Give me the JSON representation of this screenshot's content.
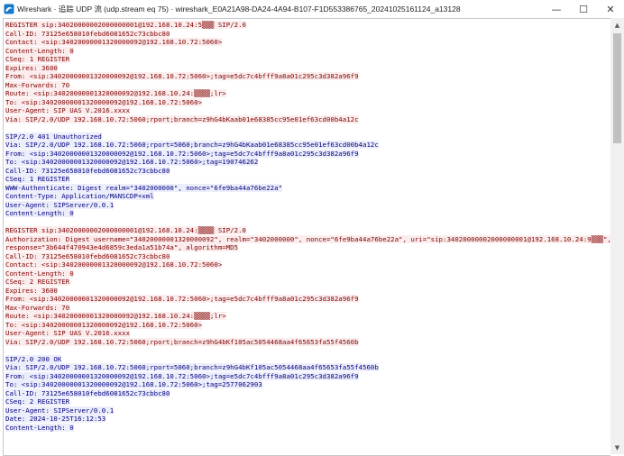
{
  "window": {
    "title": "Wireshark · 追踪 UDP 流 (udp.stream eq 75) · wireshark_E0A21A98-DA24-4A94-B107-F1D553386765_20241025161124_a13128",
    "minimize_glyph": "—",
    "maximize_glyph": "☐",
    "close_glyph": "✕"
  },
  "colors": {
    "client_fg": "#7f0000",
    "client_bg": "#fbeded",
    "server_fg": "#00007f",
    "server_bg": "#edeefb"
  },
  "blocks": [
    {
      "dir": "client",
      "lines": [
        "REGISTER sip:34020000002000000001@192.168.10.24:5▒▒▒ SIP/2.0",
        "Call-ID: 73125e658010febd6081652c73cbbc80",
        "Contact: <sip:34020000001320000092@192.168.10.72:5060>",
        "Content-Length: 0",
        "CSeq: 1 REGISTER",
        "Expires: 3600",
        "From: <sip:34020000001320000092@192.168.10.72:5060>;tag=e5dc7c4bfff9a8a01c295c3d382a96f9",
        "Max-Forwards: 70",
        "Route: <sip:34020000001320000092@192.168.10.24:▒▒▒▒;lr>",
        "To: <sip:34020000001320000092@192.168.10.72:5060>",
        "User-Agent: SIP UAS V.2016.xxxx",
        "Via: SIP/2.0/UDP 192.168.10.72:5060;rport;branch=z9hG4bKaab01e68385cc95e01ef63cd00b4a12c"
      ]
    },
    {
      "dir": "server",
      "lines": [
        "SIP/2.0 401 Unauthorized",
        "Via: SIP/2.0/UDP 192.168.10.72:5060;rport=5060;branch=z9hG4bKaab01e68385cc95e01ef63cd00b4a12c",
        "From: <sip:34020000001320000092@192.168.10.72:5060>;tag=e5dc7c4bfff9a8a01c295c3d382a96f9",
        "To: <sip:34020000001320000092@192.168.10.72:5060>;tag=190746262",
        "Call-ID: 73125e658010febd6081652c73cbbc80",
        "CSeq: 1 REGISTER",
        "WWW-Authenticate: Digest realm=\"3402000000\", nonce=\"6fe9ba44a76be22a\"",
        "Content-Type: Application/MANSCDP+xml",
        "User-Agent: SIPServer/0.0.1",
        "Content-Length: 0"
      ]
    },
    {
      "dir": "client",
      "lines": [
        "REGISTER sip:34020000002000000001@192.168.10.24:▒▒▒▒ SIP/2.0",
        "Authorization: Digest username=\"34020000001320000092\", realm=\"3402000000\", nonce=\"6fe9ba44a76be22a\", uri=\"sip:34020000002000000001@192.168.10.24:9▒▒▒\",",
        "response=\"3b644f470943e4d6859c3eda1a51b74a\", algorithm=MD5",
        "Call-ID: 73125e658010febd6081652c73cbbc80",
        "Contact: <sip:34020000001320000092@192.168.10.72:5060>",
        "Content-Length: 0",
        "CSeq: 2 REGISTER",
        "Expires: 3600",
        "From: <sip:34020000001320000092@192.168.10.72:5060>;tag=e5dc7c4bfff9a8a01c295c3d382a96f9",
        "Max-Forwards: 70",
        "Route: <sip:34020000001320000092@192.168.10.24:▒▒▒▒;lr>",
        "To: <sip:34020000001320000092@192.168.10.72:5060>",
        "User-Agent: SIP UAS V.2016.xxxx",
        "Via: SIP/2.0/UDP 192.168.10.72:5060;rport;branch=z9hG4bKf105ac5054468aa4f65653fa55f4560b"
      ]
    },
    {
      "dir": "server",
      "lines": [
        "SIP/2.0 200 OK",
        "Via: SIP/2.0/UDP 192.168.10.72:5060;rport=5060;branch=z9hG4bKf105ac5054468aa4f65653fa55f4560b",
        "From: <sip:34020000001320000092@192.168.10.72:5060>;tag=e5dc7c4bfff9a8a01c295c3d382a96f9",
        "To: <sip:34020000001320000092@192.168.10.72:5060>;tag=2577062903",
        "Call-ID: 73125e658010febd6081652c73cbbc80",
        "CSeq: 2 REGISTER",
        "User-Agent: SIPServer/0.0.1",
        "Date: 2024-10-25T16:12:53",
        "Content-Length: 0"
      ]
    }
  ]
}
